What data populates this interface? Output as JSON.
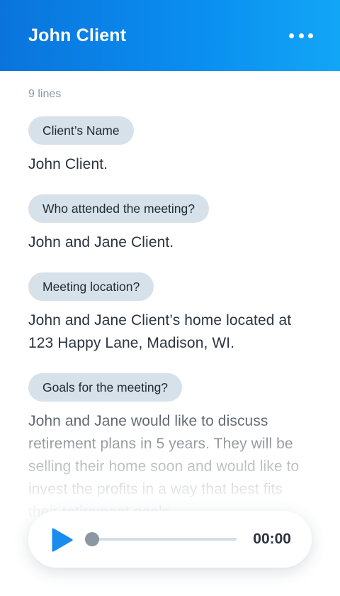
{
  "header": {
    "title": "John Client",
    "menu_icon": "more-horizontal-icon"
  },
  "notes": {
    "line_count": "9 lines",
    "items": [
      {
        "question": "Client’s Name",
        "answer": "John Client."
      },
      {
        "question": "Who attended the meeting?",
        "answer": "John and Jane Client."
      },
      {
        "question": "Meeting location?",
        "answer": "John and Jane Client’s home located at 123 Happy Lane, Madison, WI."
      },
      {
        "question": "Goals for the meeting?",
        "answer": "John and Jane would like to discuss retirement plans in 5 years. They will be selling their home soon and would like to invest the profits in a way that best fits their retirement goals."
      }
    ]
  },
  "player": {
    "play_icon": "play-icon",
    "time": "00:00",
    "progress": 0
  },
  "colors": {
    "header_start": "#0a74dc",
    "header_end": "#12a6f6",
    "accent": "#1a8cf0",
    "chip": "#d6e1e9",
    "text": "#2b3440",
    "muted": "#8c97a3"
  }
}
